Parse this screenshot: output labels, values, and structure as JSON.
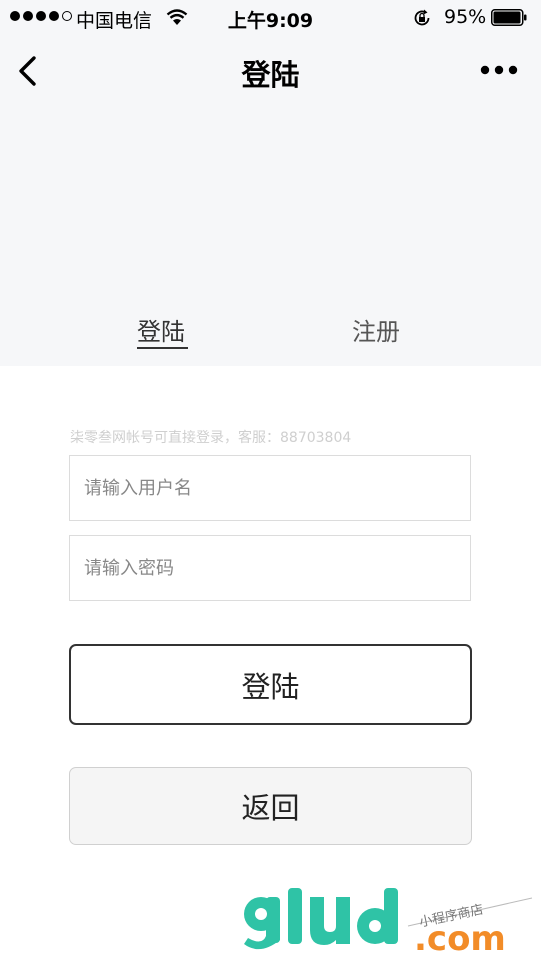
{
  "status_bar": {
    "carrier": "中国电信",
    "time": "上午9:09",
    "battery": "95%"
  },
  "nav": {
    "title": "登陆"
  },
  "tabs": [
    {
      "label": "登陆",
      "active": true
    },
    {
      "label": "注册",
      "active": false
    }
  ],
  "form": {
    "hint": "柒零叁网帐号可直接登录，客服：88703804",
    "username_placeholder": "请输入用户名",
    "password_placeholder": "请输入密码",
    "login_button": "登陆",
    "back_button": "返回"
  },
  "watermark": {
    "brand": "glud",
    "domain": ".com",
    "tagline": "小程序商店"
  },
  "colors": {
    "top_background": "#f6f7f9",
    "watermark_teal": "#2fc3a6",
    "watermark_orange": "#f28c28"
  }
}
